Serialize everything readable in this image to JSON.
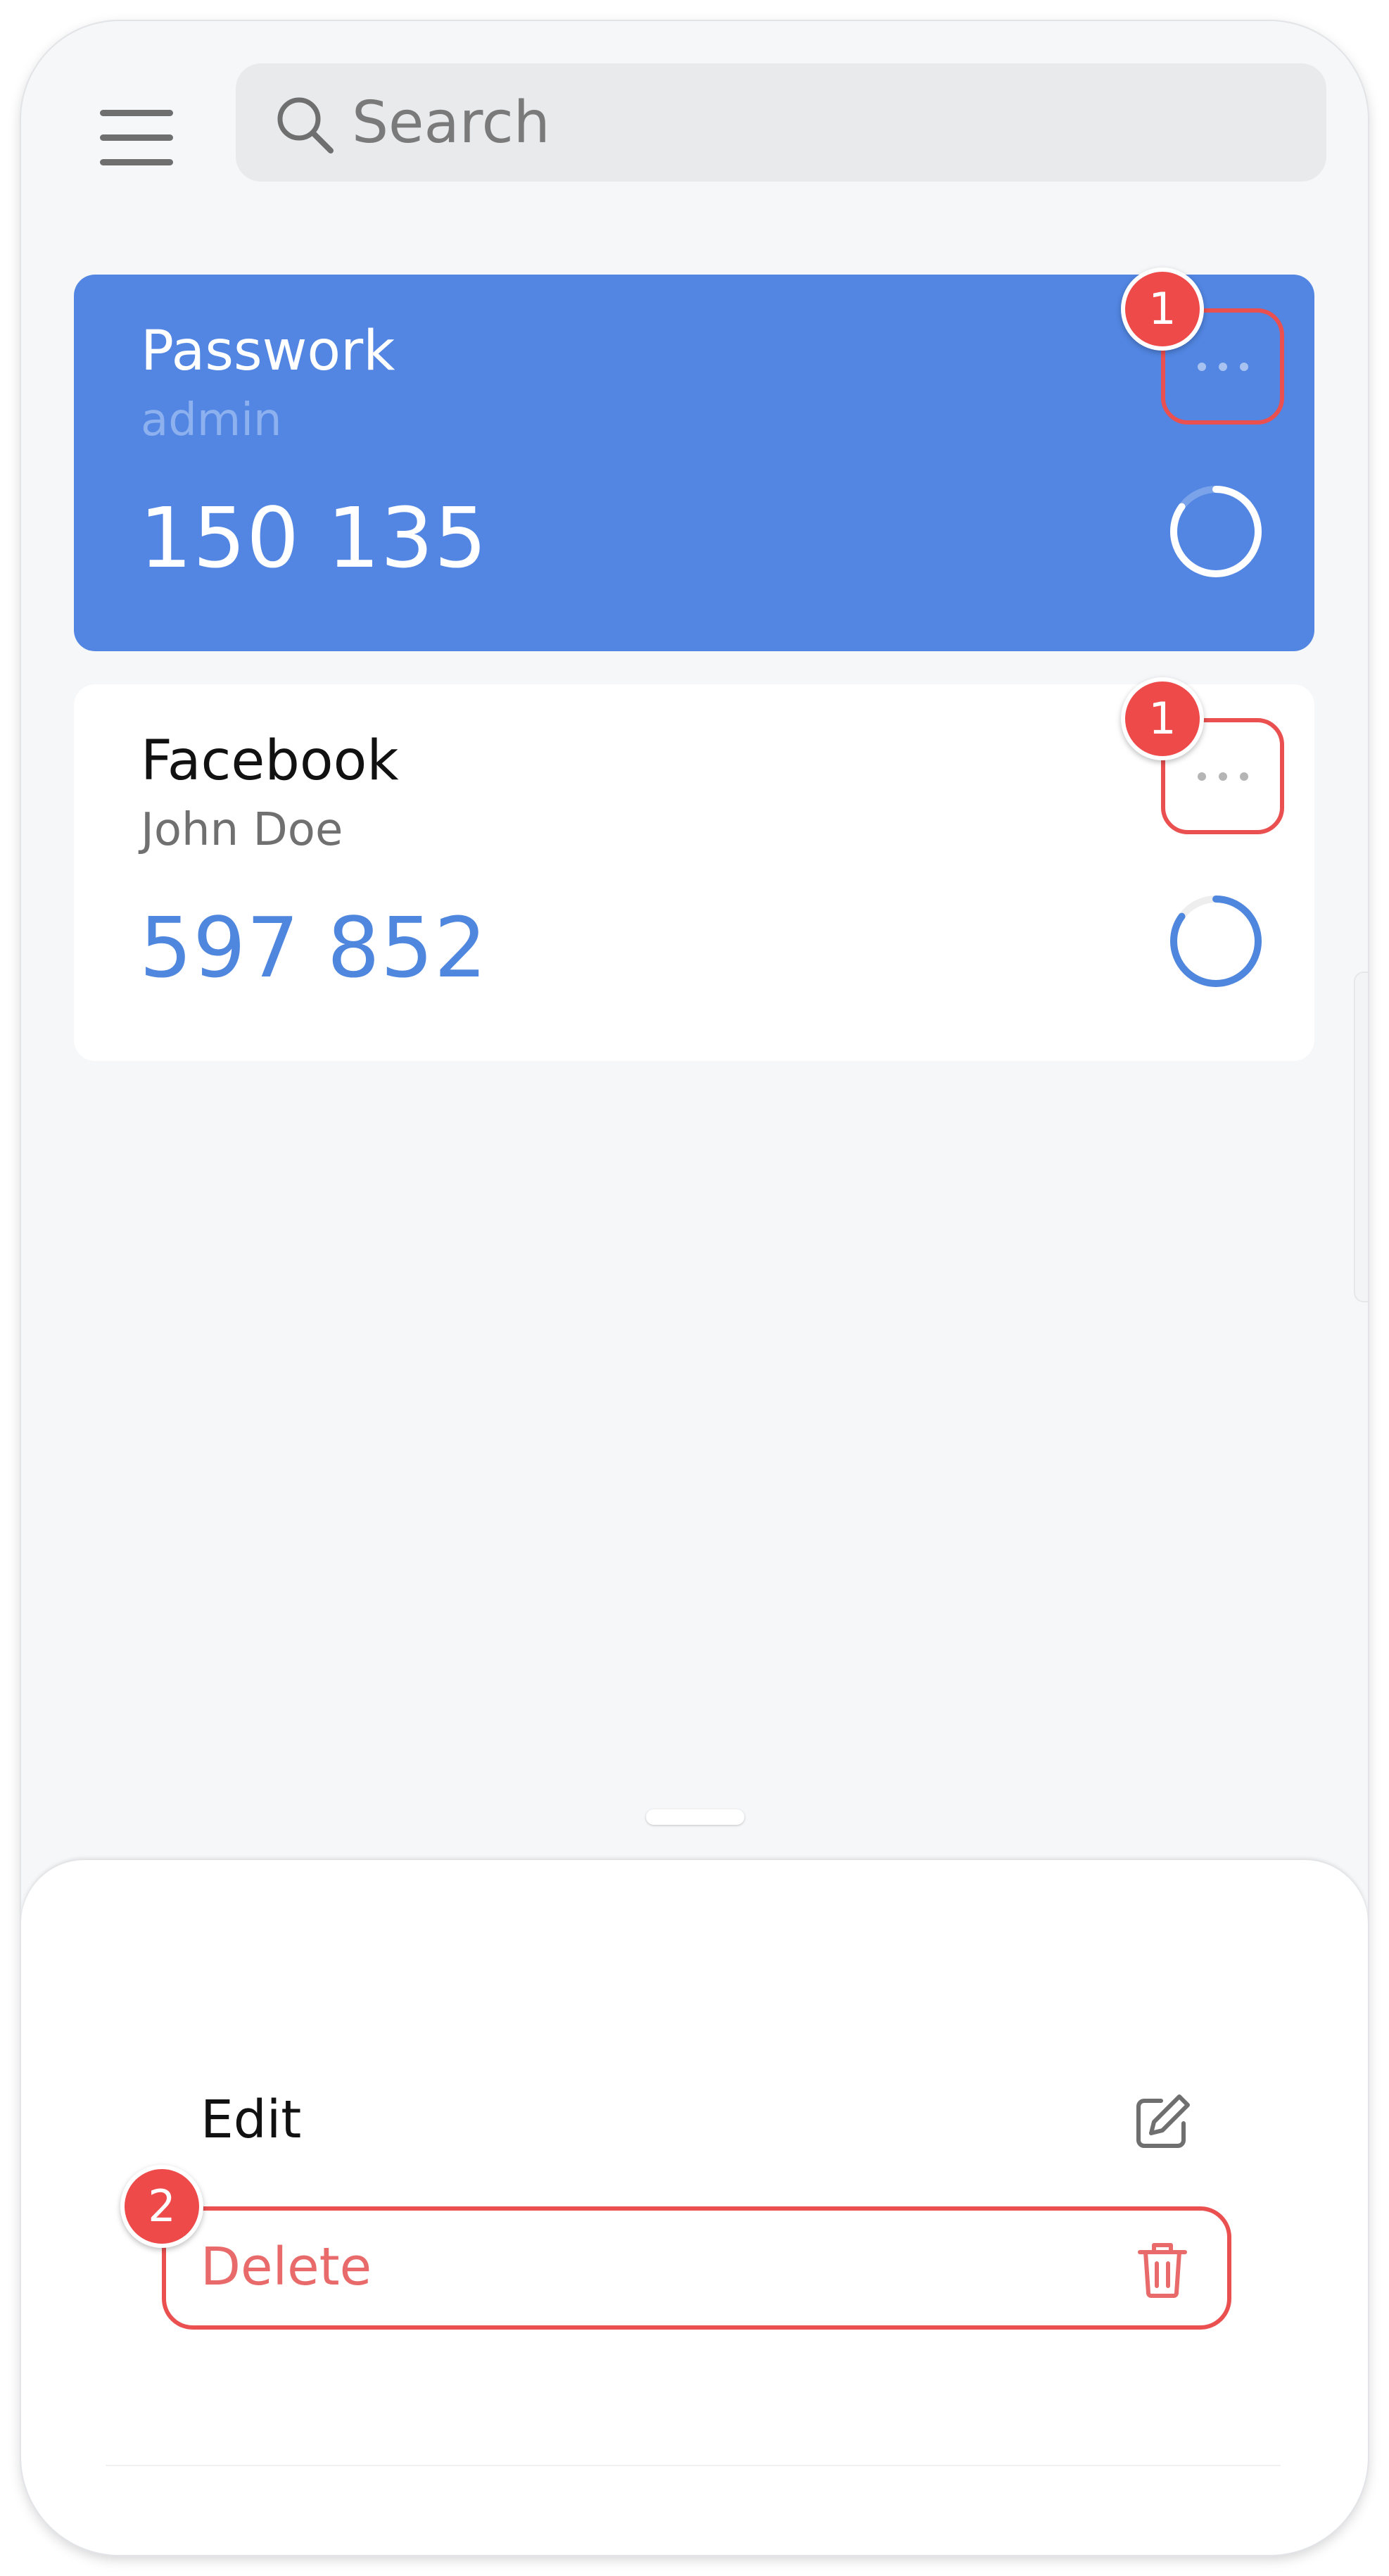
{
  "header": {
    "menu_icon": "hamburger-menu-icon",
    "search": {
      "placeholder": "Search",
      "value": "",
      "icon": "search-icon"
    }
  },
  "accounts": [
    {
      "title": "Passwork",
      "subtitle": "admin",
      "code": "150 135",
      "selected": true,
      "step_badge": "1",
      "timer_progress": 0.85
    },
    {
      "title": "Facebook",
      "subtitle": "John Doe",
      "code": "597 852",
      "selected": false,
      "step_badge": "1",
      "timer_progress": 0.85
    }
  ],
  "bottom_sheet": {
    "items": [
      {
        "label": "Edit",
        "icon": "edit-icon"
      },
      {
        "label": "Delete",
        "icon": "trash-icon",
        "step_badge": "2"
      }
    ]
  },
  "colors": {
    "accent_blue": "#5286e2",
    "highlight_red": "#ea5050",
    "delete_text": "#e86a6a",
    "background": "#f6f7f9"
  }
}
